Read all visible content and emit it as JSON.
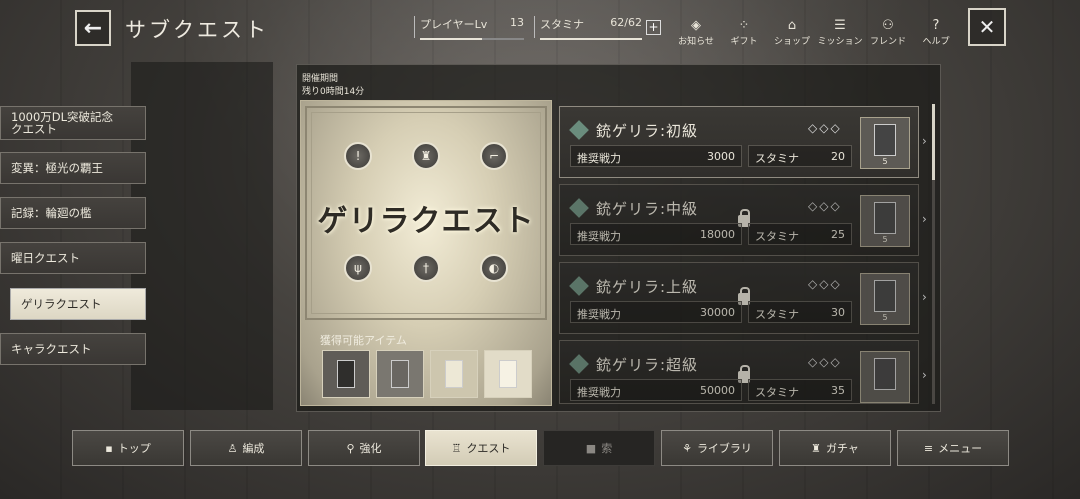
{
  "header": {
    "title": "サブクエスト",
    "player_level_label": "プレイヤーLv",
    "player_level_value": "13",
    "stamina_label": "スタミナ",
    "stamina_value": "62/62",
    "stamina_fill": 1.0,
    "player_level_fill": 0.6,
    "plus_label": "+",
    "nav": [
      {
        "label": "お知らせ",
        "icon": "notice-icon"
      },
      {
        "label": "ギフト",
        "icon": "gift-icon"
      },
      {
        "label": "ショップ",
        "icon": "shop-icon"
      },
      {
        "label": "ミッション",
        "icon": "mission-icon"
      },
      {
        "label": "フレンド",
        "icon": "friend-icon"
      },
      {
        "label": "ヘルプ",
        "icon": "help-icon"
      }
    ]
  },
  "sidebar": {
    "items": [
      {
        "label": "1000万DL突破記念\nクエスト"
      },
      {
        "label": "変異：極光の覇王"
      },
      {
        "label": "記録：輪廻の檻"
      },
      {
        "label": "曜日クエスト"
      },
      {
        "label": "ゲリラクエスト",
        "active": true
      },
      {
        "label": "キャラクエスト"
      }
    ]
  },
  "event": {
    "period_label": "開催期間",
    "period_value": "残り0時間14分",
    "banner_title": "ゲリラクエスト",
    "drop_label": "獲得可能アイテム"
  },
  "quests": [
    {
      "name": "銃ゲリラ:初級",
      "difficulty": "◇◇◇",
      "power_label": "推奨戦力",
      "power": "3000",
      "stamina_label": "スタミナ",
      "stamina": "20",
      "count": "5",
      "locked": false
    },
    {
      "name": "銃ゲリラ:中級",
      "difficulty": "◇◇◇",
      "power_label": "推奨戦力",
      "power": "18000",
      "stamina_label": "スタミナ",
      "stamina": "25",
      "count": "5",
      "locked": true
    },
    {
      "name": "銃ゲリラ:上級",
      "difficulty": "◇◇◇",
      "power_label": "推奨戦力",
      "power": "30000",
      "stamina_label": "スタミナ",
      "stamina": "30",
      "count": "5",
      "locked": true
    },
    {
      "name": "銃ゲリラ:超級",
      "difficulty": "◇◇◇",
      "power_label": "推奨戦力",
      "power": "50000",
      "stamina_label": "スタミナ",
      "stamina": "35",
      "count": "",
      "locked": true
    }
  ],
  "bottom_nav": [
    {
      "label": "トップ"
    },
    {
      "label": "編成"
    },
    {
      "label": "強化"
    },
    {
      "label": "クエスト",
      "active": true
    },
    {
      "label": "索",
      "disabled": true
    },
    {
      "label": "ライブラリ"
    },
    {
      "label": "ガチャ"
    },
    {
      "label": "メニュー"
    }
  ]
}
